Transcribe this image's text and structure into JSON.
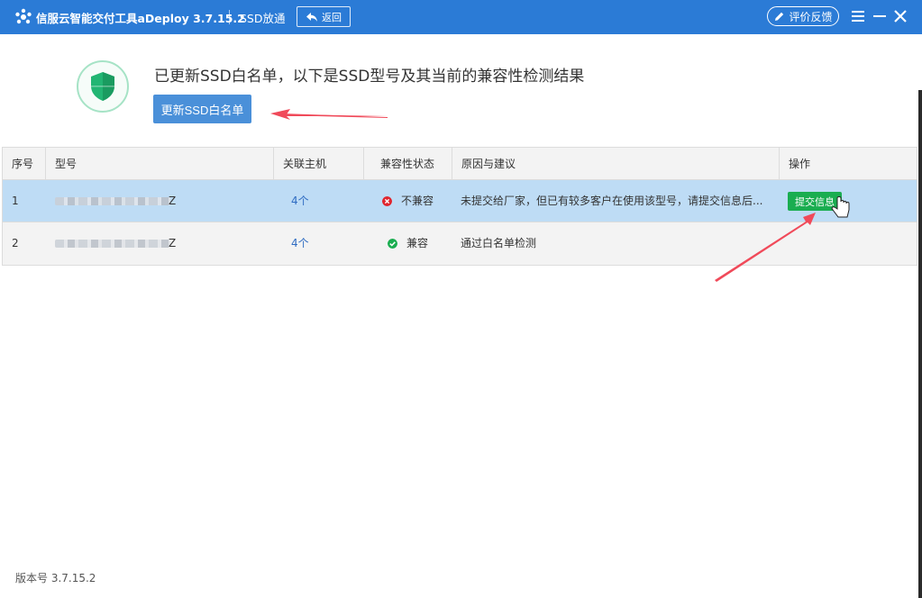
{
  "titlebar": {
    "app_title": "信服云智能交付工具aDeploy 3.7.15.2",
    "page_name": "SSD放通",
    "back_label": "返回",
    "feedback_label": "评价反馈",
    "accent_color": "#2b7bd6"
  },
  "header": {
    "title": "已更新SSD白名单，以下是SSD型号及其当前的兼容性检测结果",
    "update_button": "更新SSD白名单",
    "icon": "shield-check-icon"
  },
  "table": {
    "columns": [
      "序号",
      "型号",
      "关联主机",
      "兼容性状态",
      "原因与建议",
      "操作"
    ],
    "rows": [
      {
        "index": "1",
        "model_suffix": "Z",
        "hosts": "4个",
        "status": "不兼容",
        "status_type": "error",
        "reason": "未提交给厂家，但已有较多客户在使用该型号，请提交信息后...",
        "action": "提交信息"
      },
      {
        "index": "2",
        "model_suffix": "Z",
        "hosts": "4个",
        "status": "兼容",
        "status_type": "ok",
        "reason": "通过白名单检测",
        "action": ""
      }
    ]
  },
  "footer": {
    "version": "版本号 3.7.15.2"
  },
  "colors": {
    "primary_button": "#4a90d9",
    "success": "#1aad50",
    "error": "#e0262f",
    "selected_row": "#bedcf5",
    "annotation_arrow": "#f04a5a"
  }
}
